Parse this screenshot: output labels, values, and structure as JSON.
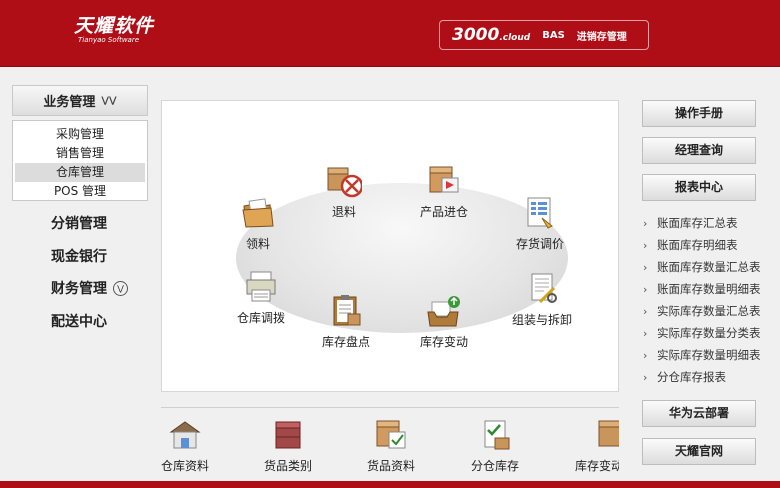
{
  "header": {
    "logo_cn": "天耀软件",
    "logo_en": "Tianyao Software",
    "product_num": "3000",
    "product_cloud": ".cloud",
    "product_bas": "BAS",
    "product_name": "进销存管理"
  },
  "sidebar": {
    "header_label": "业务管理",
    "submenu": [
      "采购管理",
      "销售管理",
      "仓库管理",
      "POS 管理"
    ],
    "selected_item": "仓库管理",
    "nav": [
      "分销管理",
      "现金银行",
      "财务管理",
      "配送中心"
    ]
  },
  "main": {
    "items": {
      "return_goods": "退料",
      "product_inbound": "产品进仓",
      "material_pick": "领料",
      "stock_adjust_price": "存货调价",
      "warehouse_transfer": "仓库调拨",
      "assembly_disassembly": "组装与拆卸",
      "stock_count": "库存盘点",
      "stock_change": "库存变动"
    }
  },
  "bottom": {
    "items": [
      "仓库资料",
      "货品类别",
      "货品资料",
      "分仓库存",
      "库存变动"
    ]
  },
  "right": {
    "manual_button": "操作手册",
    "manager_query_button": "经理查询",
    "report_center_button": "报表中心",
    "reports": [
      "账面库存汇总表",
      "账面库存明细表",
      "账面库存数量汇总表",
      "账面库存数量明细表",
      "实际库存数量汇总表",
      "实际库存数量分类表",
      "实际库存数量明细表",
      "分仓库存报表"
    ],
    "huawei_button": "华为云部署",
    "official_site_button": "天耀官网"
  },
  "colors": {
    "brand_red": "#b00e16",
    "panel_bg": "#f0f0f0"
  },
  "icons": {
    "return_goods": "box-with-cross-icon",
    "product_inbound": "box-with-arrow-icon",
    "material_pick": "folder-icon",
    "stock_adjust_price": "spreadsheet-icon",
    "warehouse_transfer": "printer-icon",
    "assembly_disassembly": "document-with-tools-icon",
    "stock_count": "clipboard-icon",
    "stock_change": "inbox-tray-icon"
  }
}
